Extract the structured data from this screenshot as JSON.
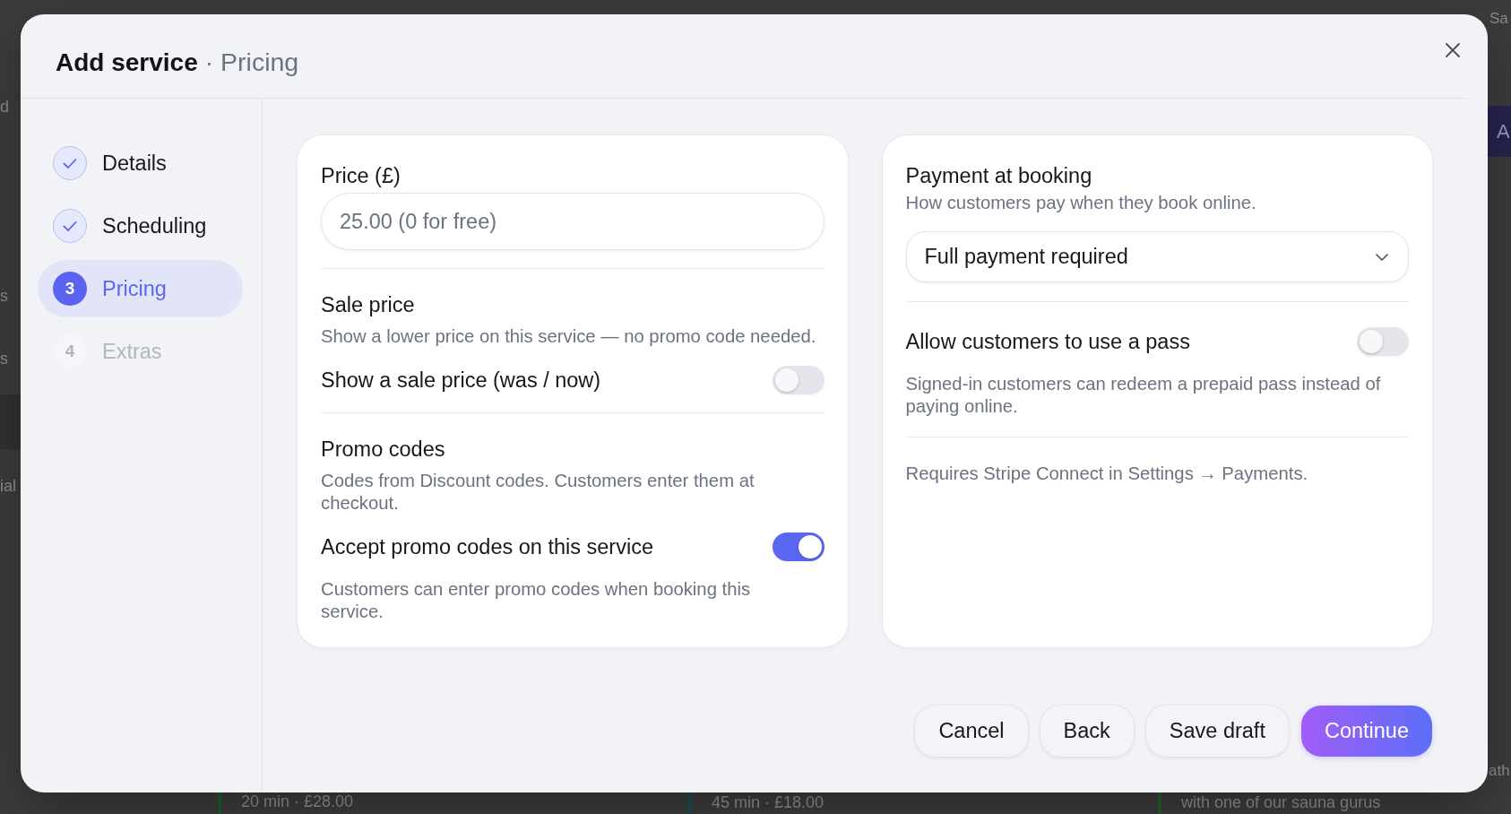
{
  "background": {
    "edge_texts": [
      "d",
      "s",
      "s",
      "ial",
      "Sa",
      "ath"
    ],
    "side_button": "A",
    "list_items": [
      {
        "text": "20 min · £28.00",
        "color": "#1f5b2b"
      },
      {
        "text": "45 min · £18.00",
        "color": "#1c4e52"
      },
      {
        "text": "with one of our sauna gurus",
        "color": "#2a5c2c"
      }
    ]
  },
  "dialog": {
    "title": "Add service",
    "separator": "·",
    "subtitle": "Pricing",
    "steps": [
      {
        "label": "Details",
        "kind": "done",
        "selected": false
      },
      {
        "label": "Scheduling",
        "kind": "done",
        "selected": false
      },
      {
        "number": "3",
        "label": "Pricing",
        "kind": "active",
        "selected": true
      },
      {
        "number": "4",
        "label": "Extras",
        "kind": "todo",
        "selected": false
      }
    ],
    "pricing_card": {
      "price_label": "Price (£)",
      "price_field": {
        "placeholder": "25.00 (0 for free)"
      },
      "sections": [
        {
          "heading": "Sale price",
          "description": "Show a lower price on this service — no promo code needed.",
          "toggle": {
            "label": "Show a sale price (was / now)",
            "on": false
          }
        },
        {
          "heading": "Promo codes",
          "description": "Codes from Discount codes. Customers enter them at checkout.",
          "toggle": {
            "label": "Accept promo codes on this service",
            "on": true
          },
          "note": "Customers can enter promo codes when booking this service."
        }
      ]
    },
    "payment_card": {
      "heading": "Payment at booking",
      "description": "How customers pay when they book online.",
      "select": {
        "value": "Full payment required"
      },
      "toggle": {
        "label": "Allow customers to use a pass",
        "on": false
      },
      "note": "Signed-in customers can redeem a prepaid pass instead of paying online.",
      "footnote": "Requires Stripe Connect in Settings → Payments."
    },
    "buttons": [
      {
        "label": "Cancel",
        "kind": "secondary"
      },
      {
        "label": "Back",
        "kind": "secondary"
      },
      {
        "label": "Save draft",
        "kind": "secondary"
      },
      {
        "label": "Continue",
        "kind": "primary"
      }
    ]
  }
}
